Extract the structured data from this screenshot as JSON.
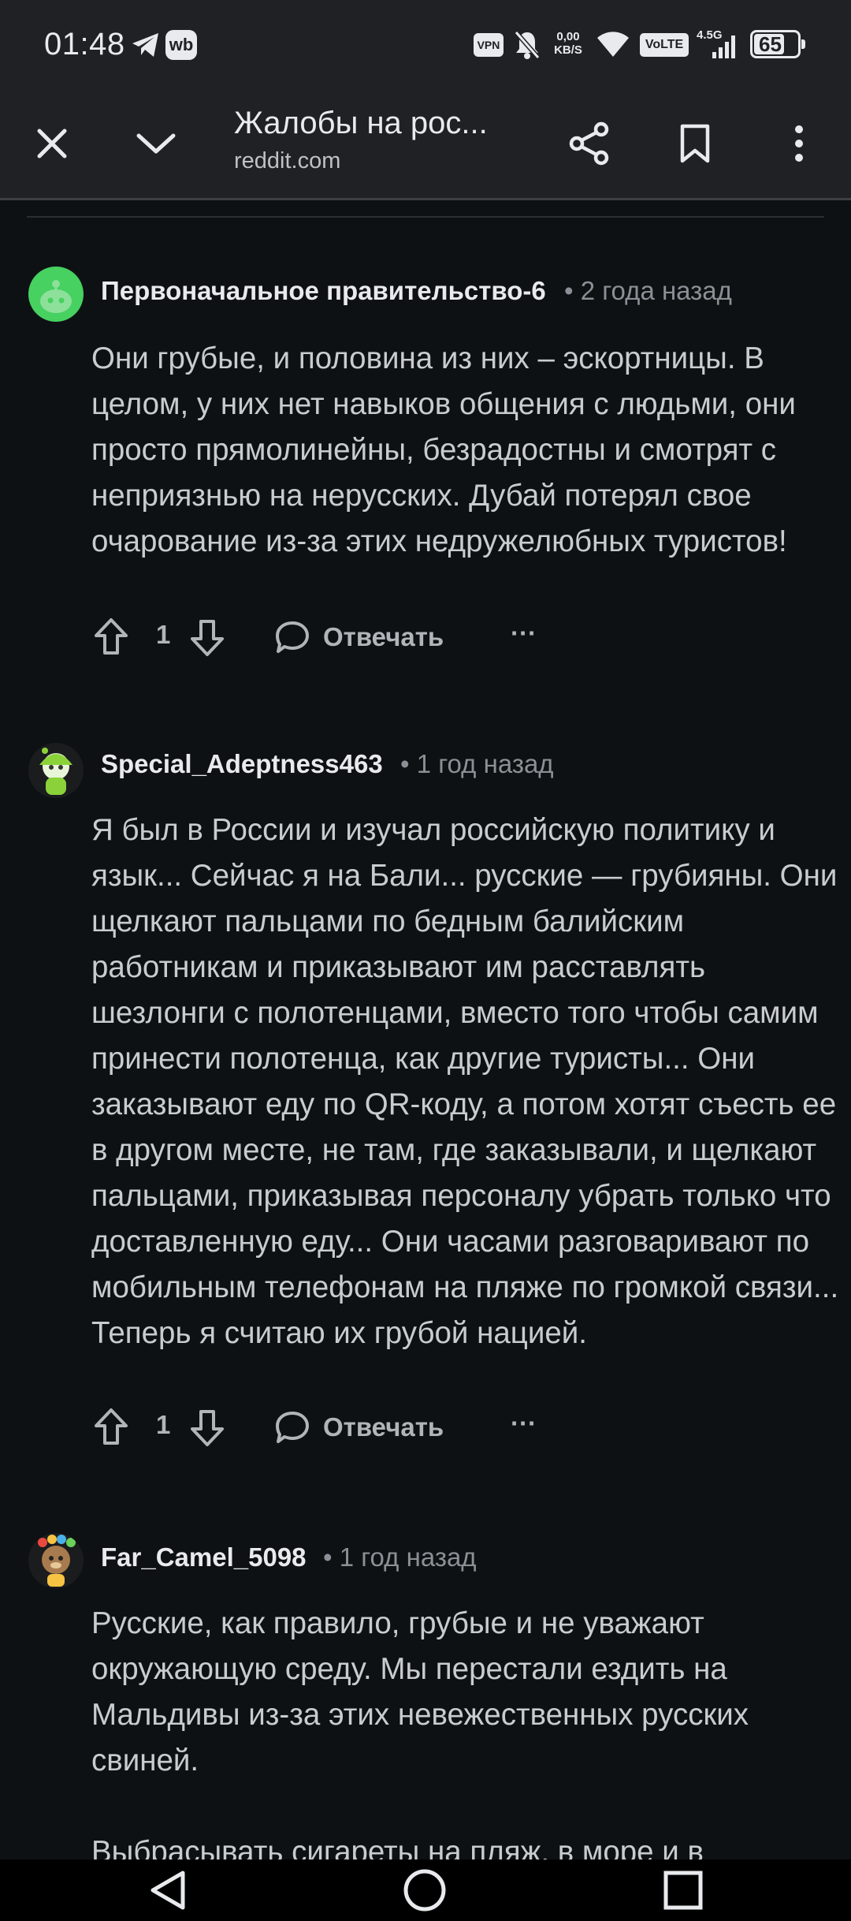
{
  "status_bar": {
    "time": "01:48",
    "vpn_label": "VPN",
    "net_speed_value": "0,00",
    "net_speed_unit": "KB/S",
    "volte_label": "VoLTE",
    "signal_label": "4.5G",
    "battery_level": "65"
  },
  "toolbar": {
    "title": "Жалобы на рос...",
    "url": "reddit.com"
  },
  "comments": [
    {
      "author": "Первоначальное правительство-6",
      "meta": "• 2 года назад",
      "paragraphs": [
        "Они грубые, и половина из них – эскортницы. В целом, у них нет навыков общения с людьми, они просто прямолинейны, безрадостны и смотрят с неприязнью на нерусских. Дубай потерял свое очарование из-за этих недружелюбных туристов!"
      ],
      "votes": "1",
      "reply_label": "Отвечать",
      "more_label": "···"
    },
    {
      "author": "Special_Adeptness463",
      "meta": "• 1 год назад",
      "paragraphs": [
        "Я был в России и изучал российскую политику и язык... Сейчас я на Бали... русские — грубияны. Они щелкают пальцами по бедным балийским работникам и приказывают им расставлять шезлонги с полотенцами, вместо того чтобы самим принести полотенца, как другие туристы... Они заказывают еду по QR-коду, а потом хотят съесть ее в другом месте, не там, где заказывали, и щелкают пальцами, приказывая персоналу убрать только что доставленную еду... Они часами разговаривают по мобильным телефонам на пляже по громкой связи... Теперь я считаю их грубой нацией."
      ],
      "votes": "1",
      "reply_label": "Отвечать",
      "more_label": "···"
    },
    {
      "author": "Far_Camel_5098",
      "meta": "• 1 год назад",
      "paragraphs": [
        "Русские, как правило, грубые и не уважают окружающую среду. Мы перестали ездить на Мальдивы из-за этих невежественных русских свиней.",
        "Выбрасывать сигареты на пляж, в море и в"
      ]
    }
  ]
}
